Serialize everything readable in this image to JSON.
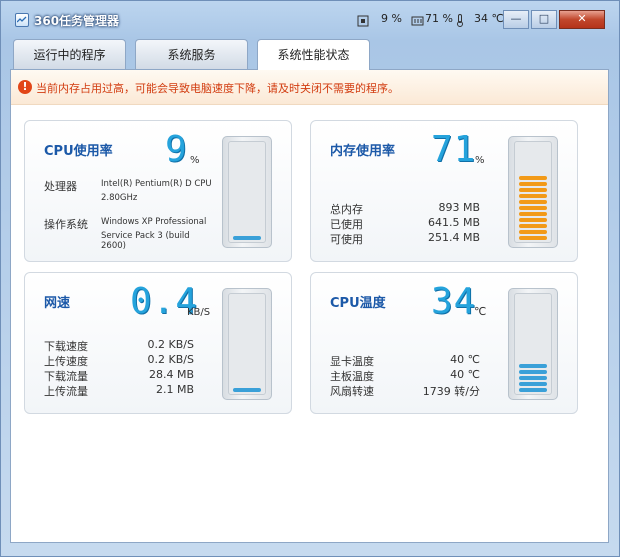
{
  "window": {
    "title": "360任务管理器",
    "stats": {
      "cpu": "9 %",
      "memory": "71 %",
      "temperature": "34 ℃"
    },
    "controls": {
      "minimize": "—",
      "maximize": "□",
      "close": "✕"
    }
  },
  "tabs": [
    {
      "label": "运行中的程序",
      "active": false
    },
    {
      "label": "系统服务",
      "active": false
    },
    {
      "label": "系统性能状态",
      "active": true
    }
  ],
  "warning": {
    "icon": "exclamation-icon",
    "text": "当前内存占用过高，可能会导致电脑速度下降，请及时关闭不需要的程序。"
  },
  "panels": {
    "cpu": {
      "title": "CPU使用率",
      "value": "9",
      "unit": "%",
      "rows": [
        {
          "k": "处理器",
          "v1": "Intel(R) Pentium(R) D CPU",
          "v2": "2.80GHz"
        },
        {
          "k": "操作系统",
          "v1": "Windows XP Professional",
          "v2": "Service Pack 3 (build 2600)"
        }
      ],
      "level_percent": 9,
      "color": "#3aa0d8"
    },
    "memory": {
      "title": "内存使用率",
      "value": "71",
      "unit": "%",
      "rows": [
        {
          "k": "总内存",
          "v": "893 MB"
        },
        {
          "k": "已使用",
          "v": "641.5 MB"
        },
        {
          "k": "可使用",
          "v": "251.4 MB"
        }
      ],
      "level_percent": 71,
      "color": "#f29a18"
    },
    "network": {
      "title": "网速",
      "value": "0.4",
      "unit": "KB/S",
      "rows": [
        {
          "k": "下载速度",
          "v": "0.2 KB/S"
        },
        {
          "k": "上传速度",
          "v": "0.2 KB/S"
        },
        {
          "k": "下载流量",
          "v": "28.4 MB"
        },
        {
          "k": "上传流量",
          "v": "2.1 MB"
        }
      ],
      "level_percent": 4,
      "color": "#3aa0d8"
    },
    "temperature": {
      "title": "CPU温度",
      "value": "34",
      "unit": "℃",
      "rows": [
        {
          "k": "显卡温度",
          "v": "40 ℃"
        },
        {
          "k": "主板温度",
          "v": "40 ℃"
        },
        {
          "k": "风扇转速",
          "v": "1739 转/分"
        }
      ],
      "level_percent": 34,
      "color": "#3aa0d8"
    }
  }
}
